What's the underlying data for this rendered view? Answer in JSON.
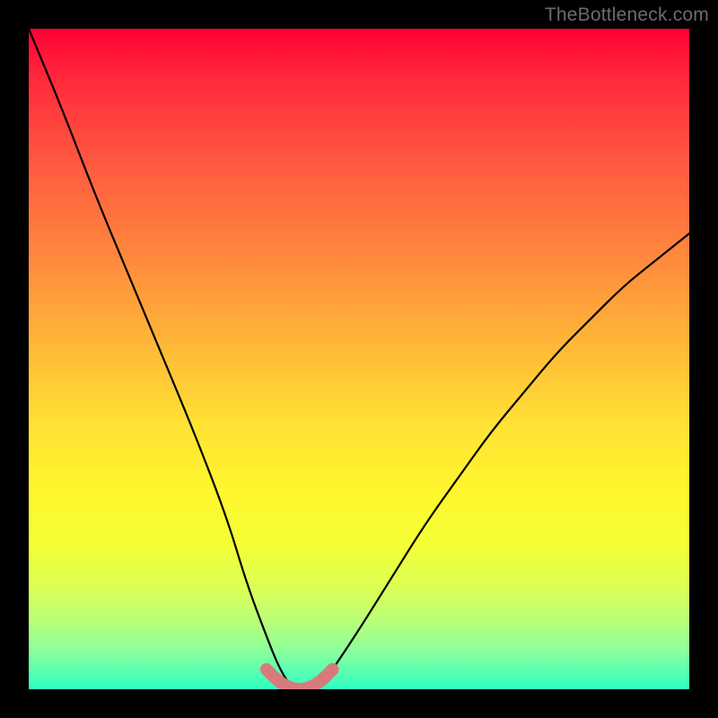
{
  "watermark": "TheBottleneck.com",
  "chart_data": {
    "type": "line",
    "title": "",
    "xlabel": "",
    "ylabel": "",
    "xlim": [
      0,
      100
    ],
    "ylim": [
      0,
      100
    ],
    "series": [
      {
        "name": "bottleneck-curve",
        "x": [
          0,
          5,
          10,
          15,
          20,
          25,
          30,
          33,
          36,
          38,
          40,
          42,
          44,
          46,
          50,
          55,
          60,
          65,
          70,
          75,
          80,
          85,
          90,
          95,
          100
        ],
        "values": [
          100,
          88,
          75,
          63,
          51,
          39,
          26,
          16,
          8,
          3,
          0,
          0,
          0,
          3,
          9,
          17,
          25,
          32,
          39,
          45,
          51,
          56,
          61,
          65,
          69
        ]
      },
      {
        "name": "optimal-band",
        "x": [
          36,
          38,
          40,
          42,
          44,
          46
        ],
        "values": [
          3,
          1,
          0,
          0,
          1,
          3
        ]
      }
    ],
    "colors": {
      "curve": "#000000",
      "band": "#d97a7a",
      "background_top": "#ff0033",
      "background_bottom": "#2fffc0"
    }
  }
}
